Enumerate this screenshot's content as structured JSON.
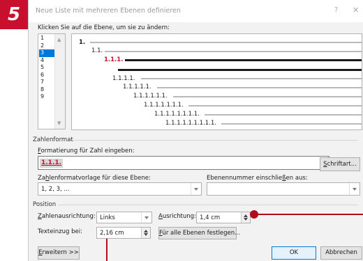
{
  "step_badge": "5",
  "dialog": {
    "title": "Neue Liste mit mehreren Ebenen definieren",
    "help_label": "?",
    "close_label": "✕",
    "level_prompt": "Klicken Sie auf die Ebene, um sie zu ändern:",
    "levels": [
      "1",
      "2",
      "3",
      "4",
      "5",
      "6",
      "7",
      "8",
      "9"
    ],
    "selected_level": "3",
    "preview_lines": [
      "1.",
      "1.1.",
      "1.1.1.",
      "1.1.1.1.",
      "1.1.1.1.1.",
      "1.1.1.1.1.1.",
      "1.1.1.1.1.1.1.",
      "1.1.1.1.1.1.1.1.",
      "1.1.1.1.1.1.1.1.1."
    ],
    "zahlenformat": {
      "section_label": "Zahlenformat",
      "format_label_pre": "F",
      "format_label_rest": "ormatierung für Zahl eingeben:",
      "format_value": "1.1.1.",
      "font_button_pre": "S",
      "font_button_rest": "chriftart...",
      "style_label_pre": "Za",
      "style_label_u": "h",
      "style_label_rest": "lenformatvorlage für diese Ebene:",
      "style_value": "1, 2, 3, ...",
      "include_label_pre": "Ebenennummer einschlie",
      "include_label_u": "ß",
      "include_label_rest": "en aus:",
      "include_value": ""
    },
    "position": {
      "section_label": "Position",
      "alignment_label_pre": "",
      "alignment_label_u": "Z",
      "alignment_label_rest": "ahlenausrichtung:",
      "alignment_value": "Links",
      "ausrichtung_label_u": "A",
      "ausrichtung_label_rest": "usrichtung:",
      "ausrichtung_value": "1,4 cm",
      "indent_label": "Texteinzug bei:",
      "indent_value": "2,16 cm",
      "all_levels_button_pre": "F",
      "all_levels_button_rest": "ür alle Ebenen festlegen..."
    },
    "footer": {
      "expand_button_pre": "E",
      "expand_button_rest": "rweitern >>",
      "ok_label": "OK",
      "cancel_label": "Abbrechen"
    }
  },
  "colors": {
    "badge_red": "#c8102e",
    "annotation_red": "#b00c1e",
    "selection_blue": "#0078d7"
  }
}
